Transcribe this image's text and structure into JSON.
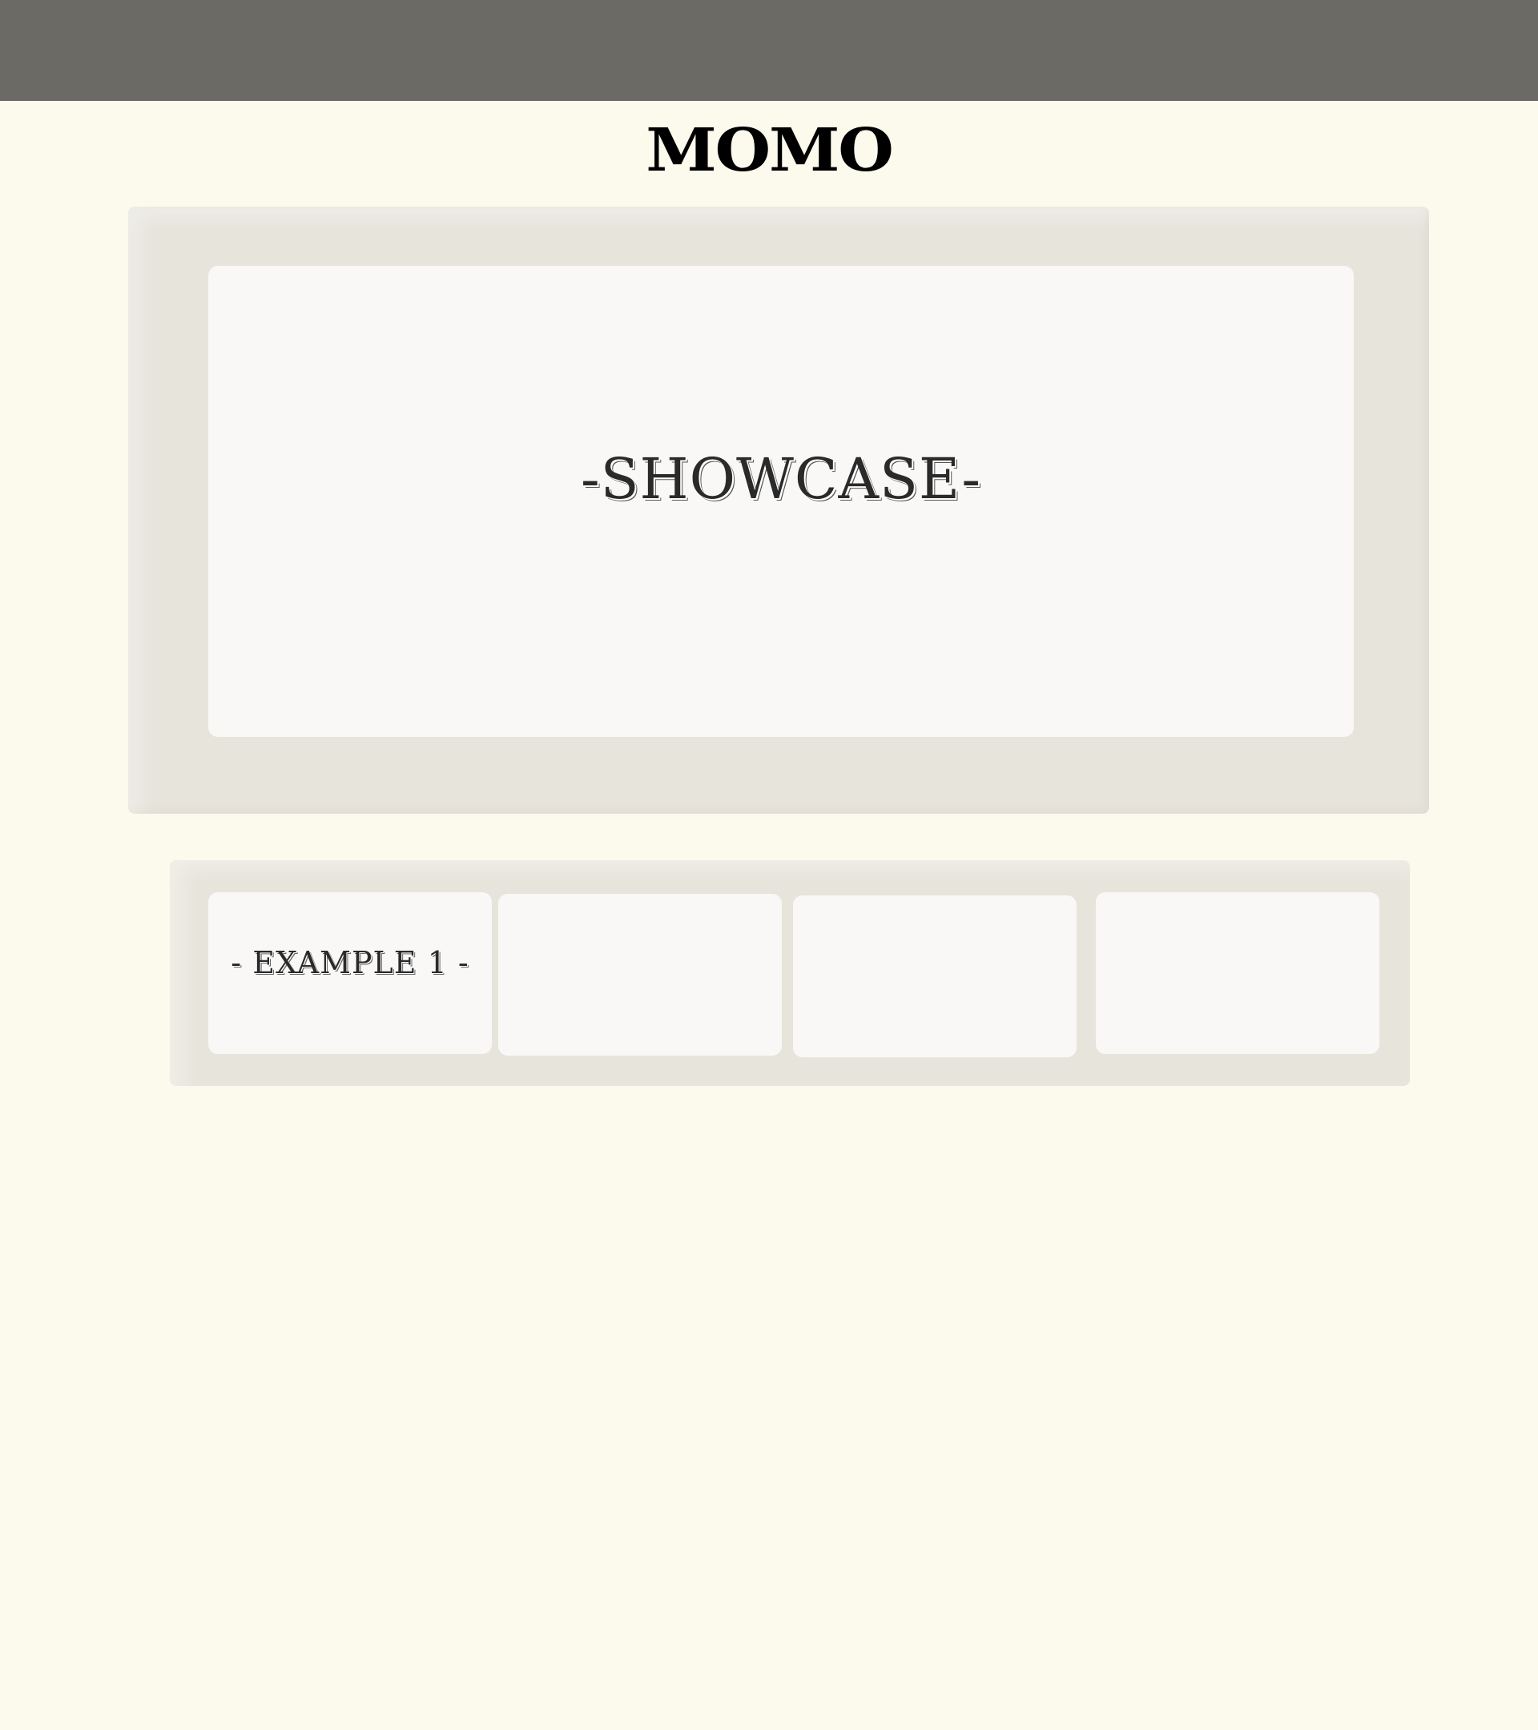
{
  "header": {
    "site_title": "MOMO"
  },
  "showcase": {
    "title": "-SHOWCASE-"
  },
  "examples": [
    {
      "label": "- EXAMPLE 1 -"
    },
    {
      "label": ""
    },
    {
      "label": ""
    },
    {
      "label": ""
    }
  ],
  "colors": {
    "background": "#fcf9ed",
    "topbar": "#6b6a65",
    "frame": "#e7e4dc",
    "panel": "#f9f8f6",
    "text": "#2a2a2a"
  }
}
